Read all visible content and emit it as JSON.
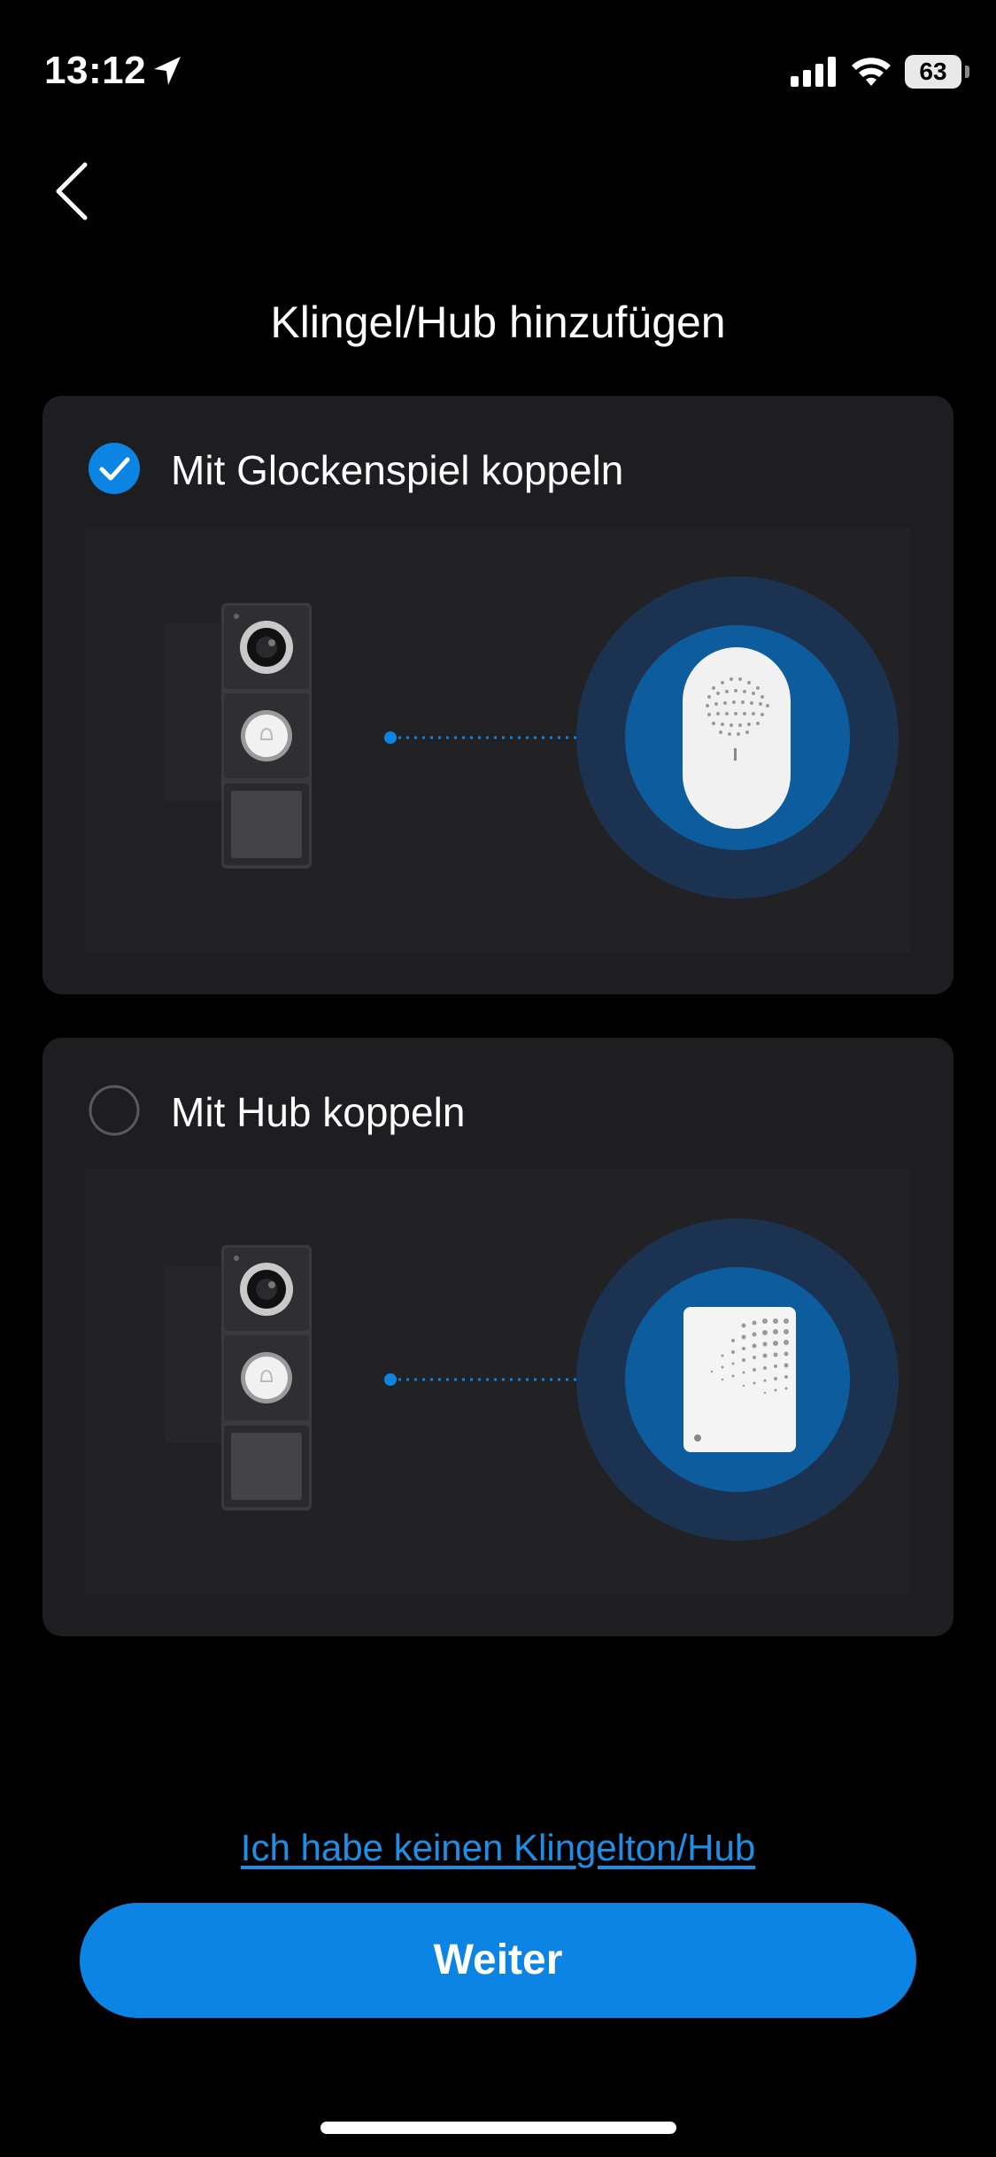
{
  "status_bar": {
    "time": "13:12",
    "battery": "63"
  },
  "page": {
    "title": "Klingel/Hub hinzufügen"
  },
  "options": [
    {
      "label": "Mit Glockenspiel koppeln",
      "selected": true,
      "device_icon": "chime-icon"
    },
    {
      "label": "Mit Hub koppeln",
      "selected": false,
      "device_icon": "hub-icon"
    }
  ],
  "footer": {
    "link_label": "Ich habe keinen Klingelton/Hub",
    "next_label": "Weiter"
  },
  "colors": {
    "accent": "#0b84e3",
    "link": "#1d8fe6",
    "card_bg": "#1e1e21",
    "halo_outer": "#1b3350",
    "halo_inner": "#0d5c9d"
  }
}
